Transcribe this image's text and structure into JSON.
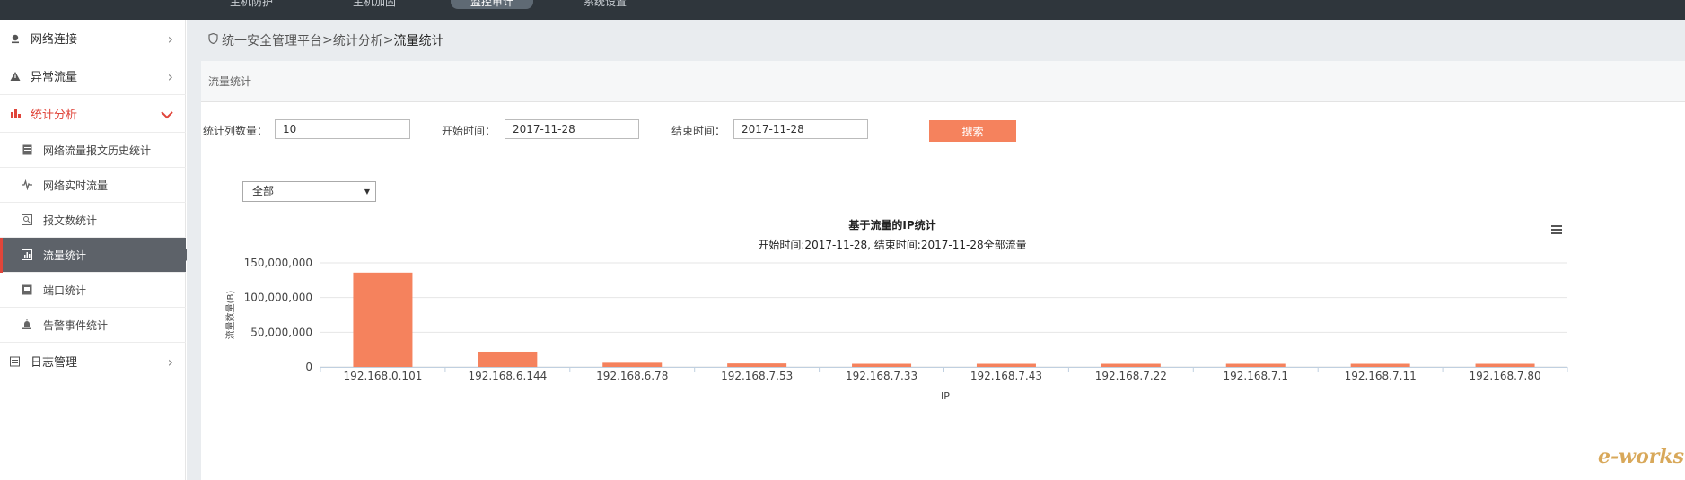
{
  "topnav": [
    {
      "label": "主机防护",
      "active": false
    },
    {
      "label": "主机加固",
      "active": false
    },
    {
      "label": "监控审计",
      "active": true
    },
    {
      "label": "系统设置",
      "active": false
    }
  ],
  "sidebar": {
    "items": [
      {
        "label": "网络连接",
        "icon": "map-pin-icon"
      },
      {
        "label": "异常流量",
        "icon": "warning-icon"
      },
      {
        "label": "统计分析",
        "icon": "bar-chart-icon"
      },
      {
        "label": "日志管理",
        "icon": "log-icon"
      }
    ],
    "subitems": [
      {
        "label": "网络流量报文历史统计",
        "icon": "document-icon"
      },
      {
        "label": "网络实时流量",
        "icon": "pulse-icon"
      },
      {
        "label": "报文数统计",
        "icon": "packet-icon"
      },
      {
        "label": "流量统计",
        "icon": "traffic-icon"
      },
      {
        "label": "端口统计",
        "icon": "port-icon"
      },
      {
        "label": "告警事件统计",
        "icon": "alarm-icon"
      }
    ]
  },
  "breadcrumb": {
    "root": "统一安全管理平台",
    "sep": " > ",
    "mid": "统计分析",
    "current": "流量统计"
  },
  "panel": {
    "title": "流量统计"
  },
  "form": {
    "count_label": "统计列数量：",
    "count_value": "10",
    "start_label": "开始时间：",
    "start_value": "2017-11-28",
    "end_label": "结束时间：",
    "end_value": "2017-11-28",
    "search_label": "搜索"
  },
  "filter": {
    "selected": "全部"
  },
  "chart_data": {
    "type": "bar",
    "title": "基于流量的IP统计",
    "subtitle": "开始时间:2017-11-28, 结束时间:2017-11-28全部流量",
    "xlabel": "IP",
    "ylabel": "流量数量(B)",
    "categories": [
      "192.168.0.101",
      "192.168.6.144",
      "192.168.6.78",
      "192.168.7.53",
      "192.168.7.33",
      "192.168.7.43",
      "192.168.7.22",
      "192.168.7.1",
      "192.168.7.11",
      "192.168.7.80"
    ],
    "values": [
      136000000,
      22000000,
      6000000,
      5000000,
      4500000,
      4500000,
      4500000,
      4500000,
      4500000,
      4500000
    ],
    "ylim": [
      0,
      150000000
    ],
    "yticks": [
      "0",
      "50,000,000",
      "100,000,000",
      "150,000,000"
    ],
    "color": "#f5825d",
    "grid": true,
    "legend": "none"
  },
  "watermark": "e-works"
}
